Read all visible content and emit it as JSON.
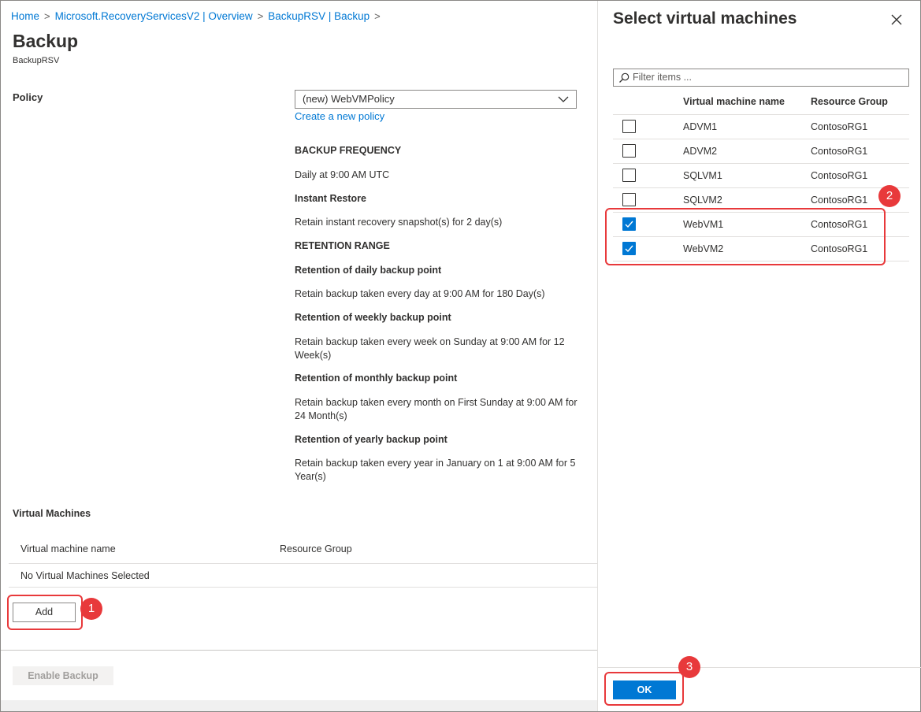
{
  "breadcrumb": {
    "items": [
      "Home",
      "Microsoft.RecoveryServicesV2 | Overview",
      "BackupRSV | Backup"
    ],
    "separator": ">"
  },
  "header": {
    "title": "Backup",
    "subtitle": "BackupRSV"
  },
  "policy": {
    "label": "Policy",
    "selected": "(new) WebVMPolicy",
    "create_link": "Create a new policy",
    "details": [
      {
        "text": "BACKUP FREQUENCY",
        "bold": true
      },
      {
        "text": "Daily at 9:00 AM UTC",
        "bold": false
      },
      {
        "text": "Instant Restore",
        "bold": true
      },
      {
        "text": "Retain instant recovery snapshot(s) for 2 day(s)",
        "bold": false
      },
      {
        "text": "RETENTION RANGE",
        "bold": true
      },
      {
        "text": "Retention of daily backup point",
        "bold": true
      },
      {
        "text": "Retain backup taken every day at 9:00 AM for 180 Day(s)",
        "bold": false
      },
      {
        "text": "Retention of weekly backup point",
        "bold": true
      },
      {
        "text": "Retain backup taken every week on Sunday at 9:00 AM for 12 Week(s)",
        "bold": false
      },
      {
        "text": "Retention of monthly backup point",
        "bold": true
      },
      {
        "text": "Retain backup taken every month on First Sunday at 9:00 AM for 24 Month(s)",
        "bold": false
      },
      {
        "text": "Retention of yearly backup point",
        "bold": true
      },
      {
        "text": "Retain backup taken every year in January on 1 at 9:00 AM for 5 Year(s)",
        "bold": false
      }
    ]
  },
  "virtual_machines": {
    "heading": "Virtual Machines",
    "columns": [
      "Virtual machine name",
      "Resource Group"
    ],
    "empty_text": "No Virtual Machines Selected",
    "add_label": "Add"
  },
  "footer": {
    "enable_label": "Enable Backup"
  },
  "select_panel": {
    "title": "Select virtual machines",
    "filter_placeholder": "Filter items ...",
    "columns": [
      "Virtual machine name",
      "Resource Group"
    ],
    "rows": [
      {
        "name": "ADVM1",
        "group": "ContosoRG1",
        "checked": false
      },
      {
        "name": "ADVM2",
        "group": "ContosoRG1",
        "checked": false
      },
      {
        "name": "SQLVM1",
        "group": "ContosoRG1",
        "checked": false
      },
      {
        "name": "SQLVM2",
        "group": "ContosoRG1",
        "checked": false
      },
      {
        "name": "WebVM1",
        "group": "ContosoRG1",
        "checked": true
      },
      {
        "name": "WebVM2",
        "group": "ContosoRG1",
        "checked": true
      }
    ],
    "ok_label": "OK"
  },
  "callouts": [
    "1",
    "2",
    "3"
  ],
  "colors": {
    "accent": "#0078d4",
    "callout": "#e8393b",
    "text": "#323130"
  }
}
